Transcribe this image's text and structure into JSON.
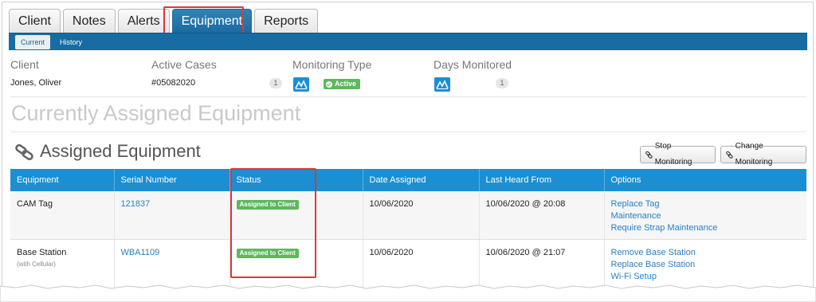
{
  "tabs": [
    "Client",
    "Notes",
    "Alerts",
    "Equipment",
    "Reports"
  ],
  "active_tab": "Equipment",
  "subtabs": {
    "current": "Current",
    "history": "History"
  },
  "info": {
    "client_label": "Client",
    "client_value": "Jones, Oliver",
    "active_cases_label": "Active Cases",
    "active_cases_value": "#05082020",
    "active_cases_count": "1",
    "monitoring_type_label": "Monitoring Type",
    "monitoring_status": "Active",
    "days_monitored_label": "Days Monitored",
    "days_monitored_count": "1"
  },
  "page_title": "Currently Assigned Equipment",
  "section_title": "Assigned Equipment",
  "buttons": {
    "stop": "Stop Monitoring",
    "change": "Change Monitoring"
  },
  "table": {
    "headers": [
      "Equipment",
      "Serial Number",
      "Status",
      "Date Assigned",
      "Last Heard From",
      "Options"
    ],
    "rows": [
      {
        "equipment": "CAM Tag",
        "equipment_sub": "",
        "serial": "121837",
        "status": "Assigned to Client",
        "date_assigned": "10/06/2020",
        "last_heard": "10/06/2020 @ 20:08",
        "options": [
          "Replace Tag",
          "Maintenance",
          "Require Strap Maintenance"
        ]
      },
      {
        "equipment": "Base Station",
        "equipment_sub": "(with Cellular)",
        "serial": "WBA1109",
        "status": "Assigned to Client",
        "date_assigned": "10/06/2020",
        "last_heard": "10/06/2020 @ 21:07",
        "options": [
          "Remove Base Station",
          "Replace Base Station",
          "Wi-Fi Setup"
        ]
      }
    ]
  },
  "colors": {
    "accent": "#176ca3",
    "header_blue": "#1b8fd1",
    "status_green": "#5cb85c",
    "highlight_red": "#d9383b",
    "link": "#2a7fc1"
  },
  "icons": [
    "monitoring-type-icon",
    "check-circle-icon",
    "chain-link-icon"
  ]
}
